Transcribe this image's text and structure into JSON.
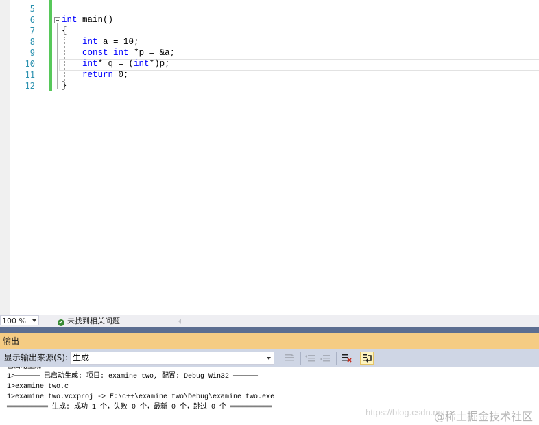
{
  "editor": {
    "line_numbers": [
      "5",
      "6",
      "7",
      "8",
      "9",
      "10",
      "11",
      "12"
    ],
    "lines": [
      {
        "parts": []
      },
      {
        "parts": [
          {
            "t": "int",
            "kw": true
          },
          {
            "t": " main()",
            "kw": false
          }
        ]
      },
      {
        "parts": [
          {
            "t": "{",
            "kw": false
          }
        ]
      },
      {
        "parts": [
          {
            "t": "    ",
            "kw": false
          },
          {
            "t": "int",
            "kw": true
          },
          {
            "t": " a = 10;",
            "kw": false
          }
        ]
      },
      {
        "parts": [
          {
            "t": "    ",
            "kw": false
          },
          {
            "t": "const",
            "kw": true
          },
          {
            "t": " ",
            "kw": false
          },
          {
            "t": "int",
            "kw": true
          },
          {
            "t": " *p = &a;",
            "kw": false
          }
        ]
      },
      {
        "parts": [
          {
            "t": "    ",
            "kw": false
          },
          {
            "t": "int",
            "kw": true
          },
          {
            "t": "* q = (",
            "kw": false
          },
          {
            "t": "int",
            "kw": true
          },
          {
            "t": "*)p;",
            "kw": false
          }
        ]
      },
      {
        "parts": [
          {
            "t": "    ",
            "kw": false
          },
          {
            "t": "return",
            "kw": true
          },
          {
            "t": " 0;",
            "kw": false
          }
        ]
      },
      {
        "parts": [
          {
            "t": "}",
            "kw": false
          }
        ]
      }
    ],
    "keyword_color": "#0000ff",
    "line_number_color": "#2b91af",
    "change_bar_color": "#57c85a"
  },
  "statusbar": {
    "zoom": "100 %",
    "issues": "未找到相关问题",
    "check_icon": "check-circle-icon"
  },
  "output": {
    "title": "输出",
    "source_label": "显示输出来源(S):",
    "source_value": "生成",
    "toolbar_icons": [
      "find-in-output-icon",
      "go-to-previous-icon",
      "go-to-next-icon",
      "clear-all-icon",
      "toggle-word-wrap-icon"
    ],
    "lines": [
      "已启动生成",
      "1>────── 已启动生成: 项目: examine two, 配置: Debug Win32 ──────",
      "1>examine two.c",
      "1>examine two.vcxproj -> E:\\c++\\examine two\\Debug\\examine two.exe",
      "══════════ 生成: 成功 1 个，失败 0 个，最新 0 个，跳过 0 个 ══════════"
    ],
    "watermark_url": "https://blog.csdn.net",
    "watermark_text": "@稀土掘金技术社区",
    "title_bg": "#f5cc84",
    "toolbar_bg": "#cfd6e5"
  }
}
